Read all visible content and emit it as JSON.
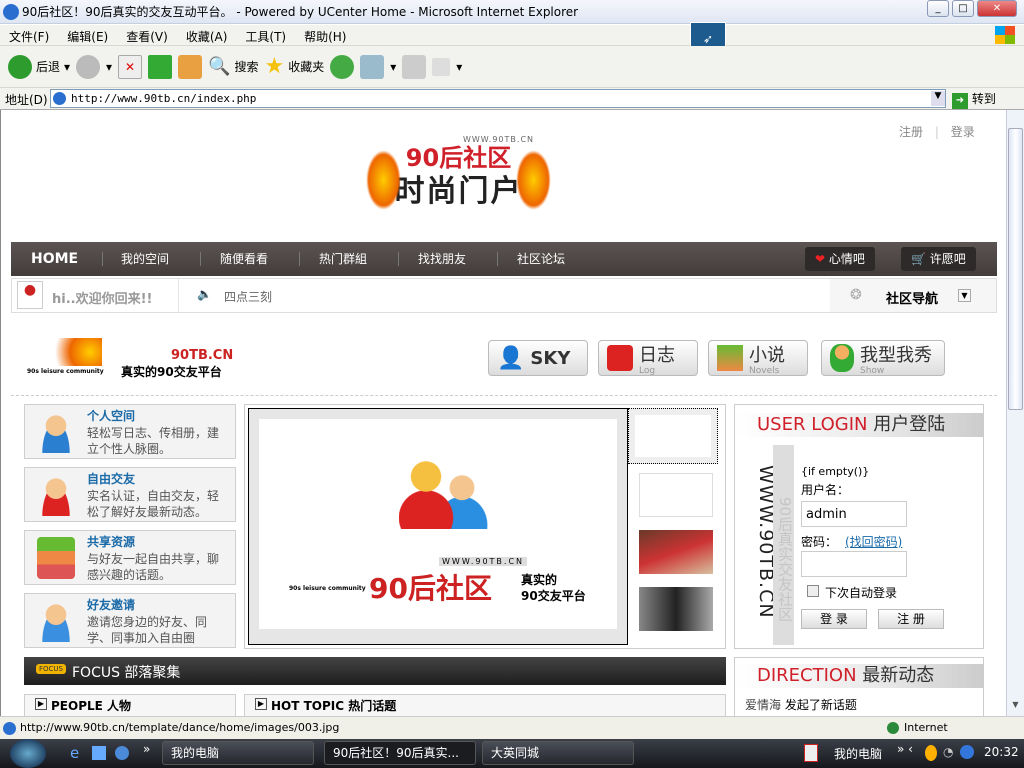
{
  "window": {
    "title": "90后社区！90后真实的交友互动平台。 - Powered by UCenter Home - Microsoft Internet Explorer"
  },
  "menu": [
    "文件(F)",
    "编辑(E)",
    "查看(V)",
    "收藏(A)",
    "工具(T)",
    "帮助(H)"
  ],
  "toolbar": {
    "back": "后退",
    "search": "搜索",
    "favorites": "收藏夹"
  },
  "address": {
    "label": "地址(D)",
    "url": "http://www.90tb.cn/index.php",
    "go": "转到"
  },
  "top_links": {
    "register": "注册",
    "login": "登录"
  },
  "logo": {
    "text": "90后社区",
    "sub": "时尚门户",
    "url": "WWW.90TB.CN"
  },
  "nav": {
    "items": [
      "HOME",
      "我的空间",
      "随便看看",
      "热门群組",
      "找找朋友",
      "社区论坛"
    ],
    "mood": "心情吧",
    "wish": "许愿吧"
  },
  "welcome": {
    "greeting": "hi..欢迎你回来!!",
    "notice": "四点三刻",
    "community_nav": "社区导航"
  },
  "brand": {
    "site": "90TB.CN",
    "slogan": "真实的90交友平台",
    "community": "90s leisure community"
  },
  "quick": [
    {
      "label": "SKY",
      "sub": ""
    },
    {
      "label": "日志",
      "sub": "Log"
    },
    {
      "label": "小说",
      "sub": "Novels"
    },
    {
      "label": "我型我秀",
      "sub": "Show"
    }
  ],
  "features": [
    {
      "title": "个人空间",
      "desc": "轻松写日志、传相册，建立个性人脉圈。"
    },
    {
      "title": "自由交友",
      "desc": "实名认证，自由交友，轻松了解好友最新动态。"
    },
    {
      "title": "共享资源",
      "desc": "与好友一起自由共享，聊感兴趣的话题。"
    },
    {
      "title": "好友邀请",
      "desc": "邀请您身边的好友、同学、同事加入自由圈"
    }
  ],
  "slide": {
    "url": "WWW.90TB.CN",
    "title": "90后社区",
    "slogan1": "真实的",
    "slogan2": "90交友平台",
    "community": "90s leisure community"
  },
  "login": {
    "title_en": "USER LOGIN",
    "title_cn": "用户登陆",
    "side": "WWW.90TB.CN",
    "side2": "90后真实交友社区",
    "tpl": "{if empty()}",
    "username_label": "用户名：",
    "username": "admin",
    "password_label": "密码：",
    "forgot": "(找回密码)",
    "remember": "下次自动登录",
    "login_btn": "登 录",
    "register_btn": "注 册"
  },
  "focus": {
    "badge": "FOCUS",
    "title": "FOCUS 部落聚集"
  },
  "people": "PEOPLE 人物",
  "hot": "HOT TOPIC 热门话题",
  "direction": {
    "title_en": "DIRECTION",
    "title_cn": "最新动态",
    "user": "爱情海",
    "action": "发起了新话题"
  },
  "status": {
    "url": "http://www.90tb.cn/template/dance/home/images/003.jpg",
    "zone": "Internet"
  },
  "taskbar": {
    "tasks": [
      "我的电脑",
      "90后社区！90后真实...",
      "大英同城"
    ],
    "tray_label": "我的电脑",
    "clock": "20:32"
  },
  "colors": {
    "accent_red": "#d0202a",
    "link_blue": "#1a6aa8",
    "nav_bg": "#4a4443"
  }
}
